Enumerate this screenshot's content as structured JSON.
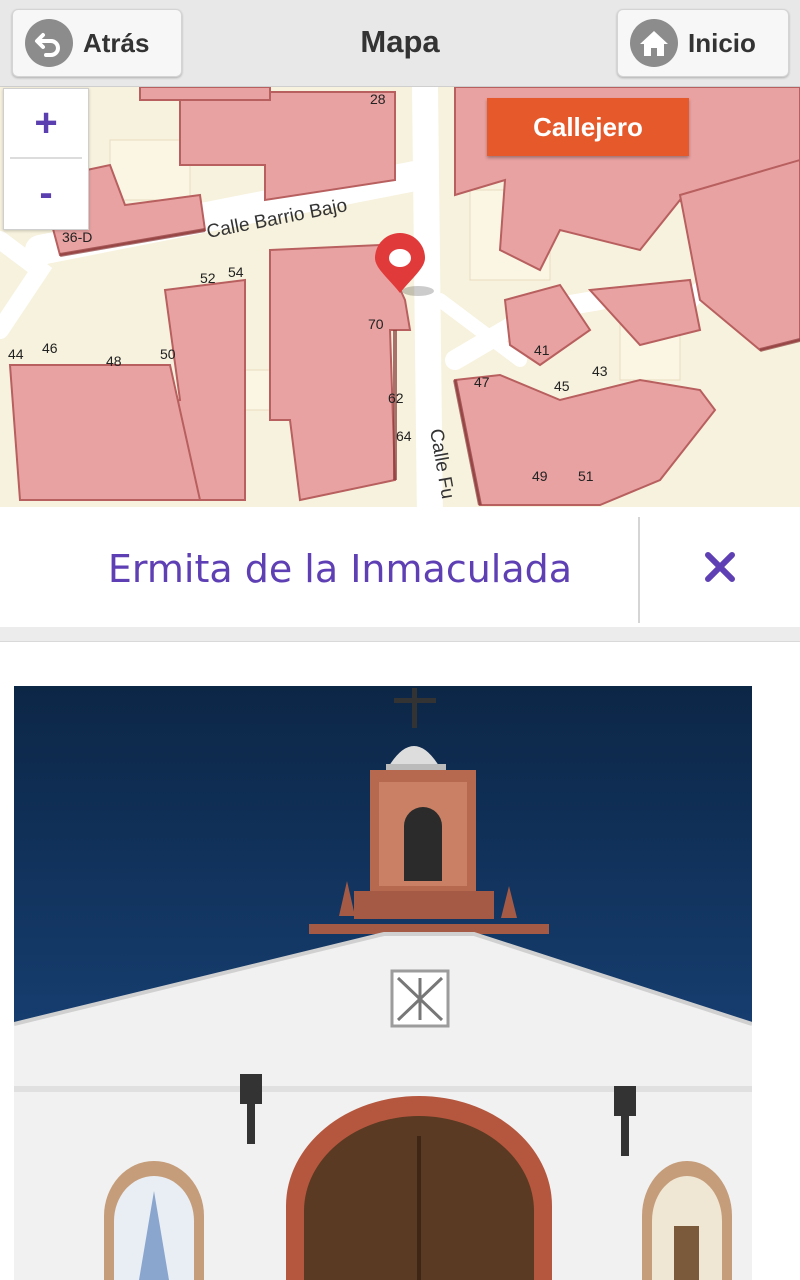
{
  "header": {
    "back_label": "Atrás",
    "title": "Mapa",
    "home_label": "Inicio"
  },
  "map": {
    "zoom_in": "+",
    "zoom_out": "-",
    "layer_button": "Callejero",
    "streets": [
      "Calle Barrio Bajo",
      "Calle Fu"
    ],
    "house_numbers": [
      "28",
      "36-D",
      "52",
      "54",
      "70",
      "44",
      "46",
      "48",
      "50",
      "62",
      "64",
      "41",
      "47",
      "45",
      "43",
      "49",
      "51"
    ]
  },
  "poi": {
    "name": "Ermita de la Inmaculada"
  },
  "colors": {
    "accent": "#5e3fb4",
    "layer_button": "#e5592a",
    "building": "#e9a2a2",
    "building_shadow": "#8a3a3a",
    "land": "#f7f2dd",
    "road": "#ffffff",
    "pin": "#e03a3a"
  },
  "icons": {
    "back": "back-arrow-icon",
    "home": "home-icon",
    "close": "close-icon",
    "pin": "map-pin-icon"
  }
}
